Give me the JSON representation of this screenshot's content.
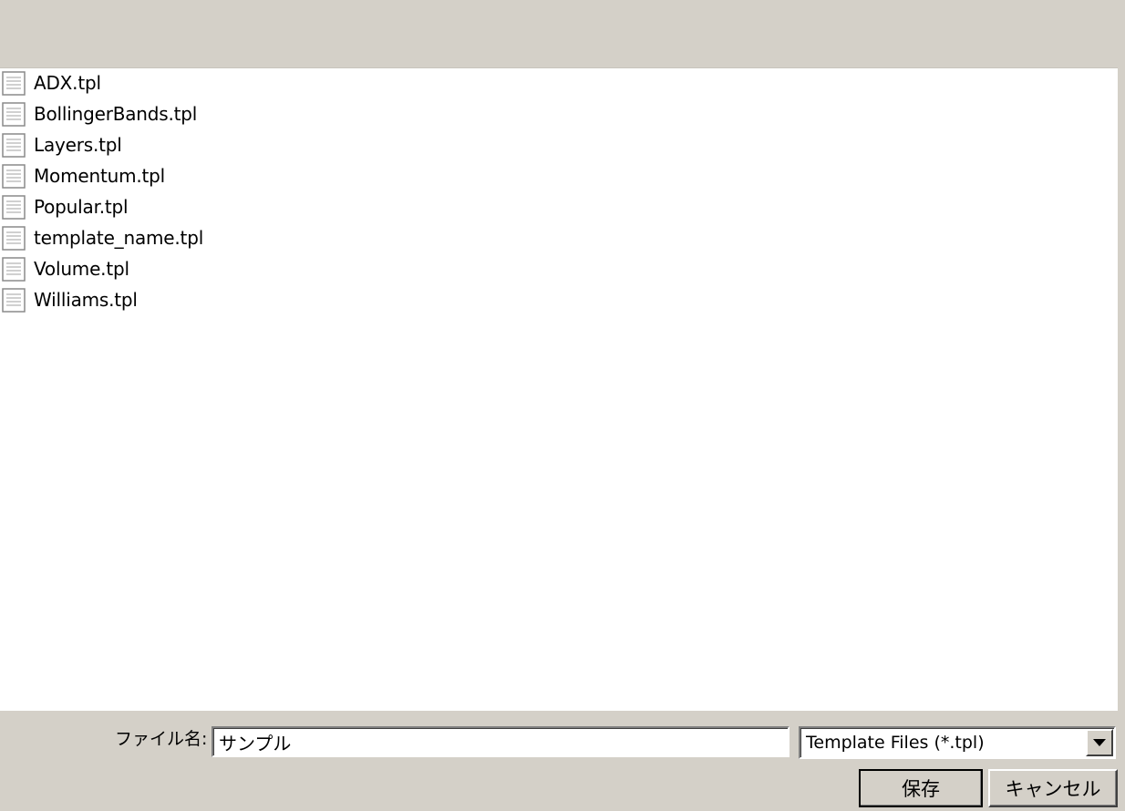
{
  "files": [
    {
      "name": "ADX.tpl",
      "icon": "document-icon"
    },
    {
      "name": "BollingerBands.tpl",
      "icon": "document-icon"
    },
    {
      "name": "Layers.tpl",
      "icon": "document-icon"
    },
    {
      "name": "Momentum.tpl",
      "icon": "document-icon"
    },
    {
      "name": "Popular.tpl",
      "icon": "document-icon"
    },
    {
      "name": "template_name.tpl",
      "icon": "document-icon"
    },
    {
      "name": "Volume.tpl",
      "icon": "document-icon"
    },
    {
      "name": "Williams.tpl",
      "icon": "document-icon"
    }
  ],
  "footer": {
    "filename_label": "ファイル名:",
    "filename_value": "サンプル",
    "filetype_value": "Template Files (*.tpl)",
    "save_label": "保存",
    "cancel_label": "キャンセル"
  },
  "colors": {
    "dialog_background": "#d4d0c8",
    "list_background": "#ffffff"
  }
}
